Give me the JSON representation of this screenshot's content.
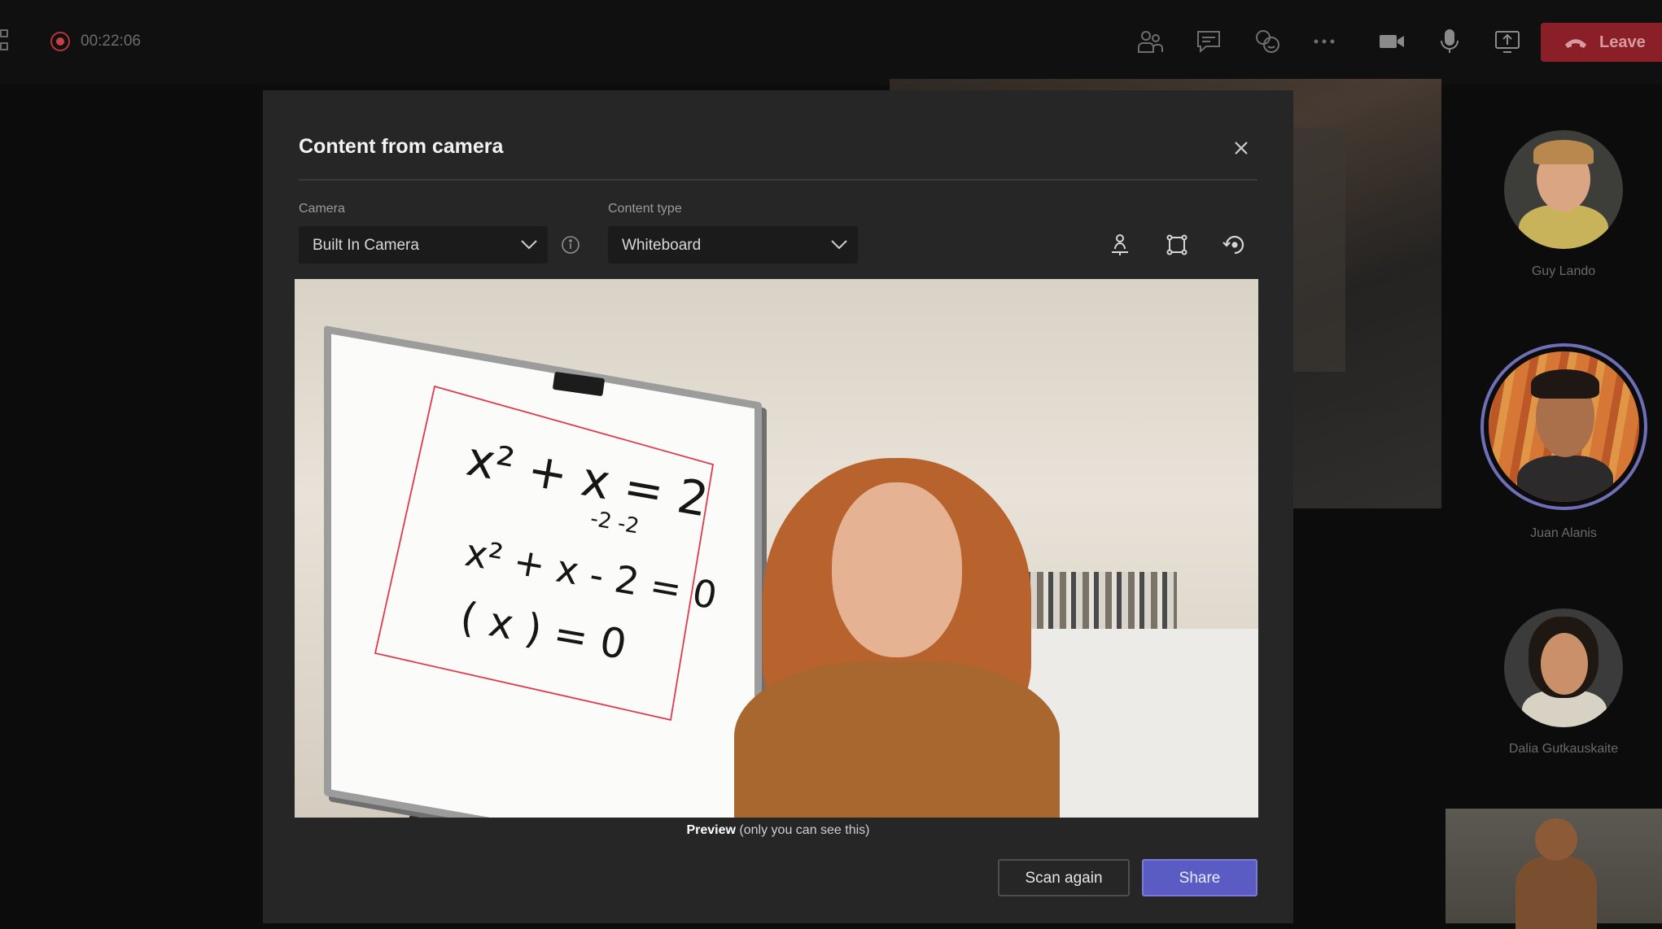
{
  "meeting": {
    "timer": "00:22:06",
    "leave_label": "Leave",
    "toolbar_icons": [
      "people-icon",
      "chat-icon",
      "reactions-icon",
      "more-icon",
      "camera-icon",
      "microphone-icon",
      "share-screen-icon"
    ]
  },
  "participants": [
    {
      "name": "Guy Lando"
    },
    {
      "name": "Juan Alanis",
      "active_speaker": true
    },
    {
      "name": "Dalia Gutkauskaite"
    }
  ],
  "dialog": {
    "title": "Content from camera",
    "camera_label": "Camera",
    "camera_value": "Built In Camera",
    "content_type_label": "Content type",
    "content_type_value": "Whiteboard",
    "tools": [
      "presenter-icon",
      "crop-icon",
      "rotate-icon"
    ],
    "whiteboard_lines": [
      "x² + x = 2",
      "-2   -2",
      "x² + x - 2 = 0",
      "(    x    ) = 0"
    ],
    "preview_bold": "Preview",
    "preview_note": "(only you can see this)",
    "scan_again_label": "Scan again",
    "share_label": "Share"
  },
  "colors": {
    "accent": "#5b5bc4",
    "leave": "#8b1f28",
    "detection_outline": "#e03a4a"
  }
}
